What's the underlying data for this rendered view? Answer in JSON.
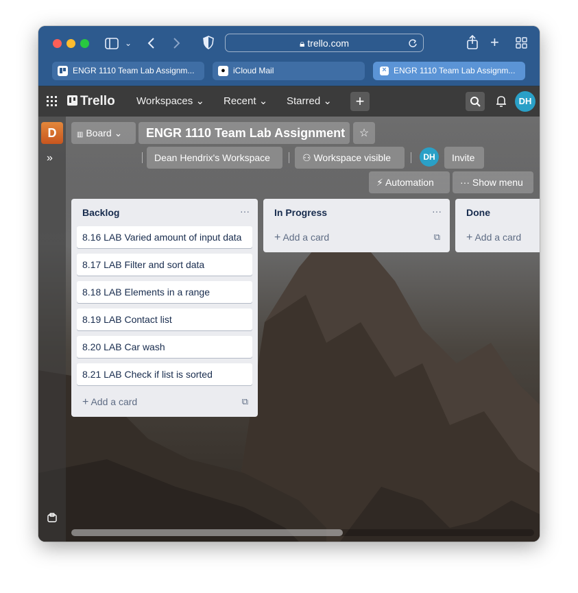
{
  "browser": {
    "url": "trello.com",
    "tabs": [
      {
        "label": "ENGR 1110 Team Lab Assignm...",
        "active": false
      },
      {
        "label": "iCloud Mail",
        "active": false
      },
      {
        "label": "ENGR 1110 Team Lab Assignm...",
        "active": true
      }
    ]
  },
  "header": {
    "logo": "Trello",
    "workspaces": "Workspaces",
    "recent": "Recent",
    "starred": "Starred",
    "create": "+",
    "avatar": "DH"
  },
  "sidebar": {
    "workspace_initial": "D",
    "expand": "»"
  },
  "board": {
    "view": "Board",
    "title": "ENGR 1110 Team Lab Assignment",
    "workspace": "Dean Hendrix's Workspace",
    "visibility": "Workspace visible",
    "member_avatar": "DH",
    "invite": "Invite",
    "automation": "Automation",
    "show_menu": "Show menu"
  },
  "lists": [
    {
      "title": "Backlog",
      "cards": [
        "8.16 LAB Varied amount of input data",
        "8.17 LAB Filter and sort data",
        "8.18 LAB Elements in a range",
        "8.19 LAB Contact list",
        "8.20 LAB Car wash",
        "8.21 LAB Check if list is sorted"
      ],
      "add": "Add a card"
    },
    {
      "title": "In Progress",
      "cards": [],
      "add": "Add a card"
    },
    {
      "title": "Done",
      "cards": [],
      "add": "Add a card"
    }
  ],
  "colors": {
    "safari_toolbar": "#2d5a8e",
    "trello_header": "#3b3b3b",
    "list_bg": "#ebecf0",
    "avatar": "#2aa0c7"
  }
}
